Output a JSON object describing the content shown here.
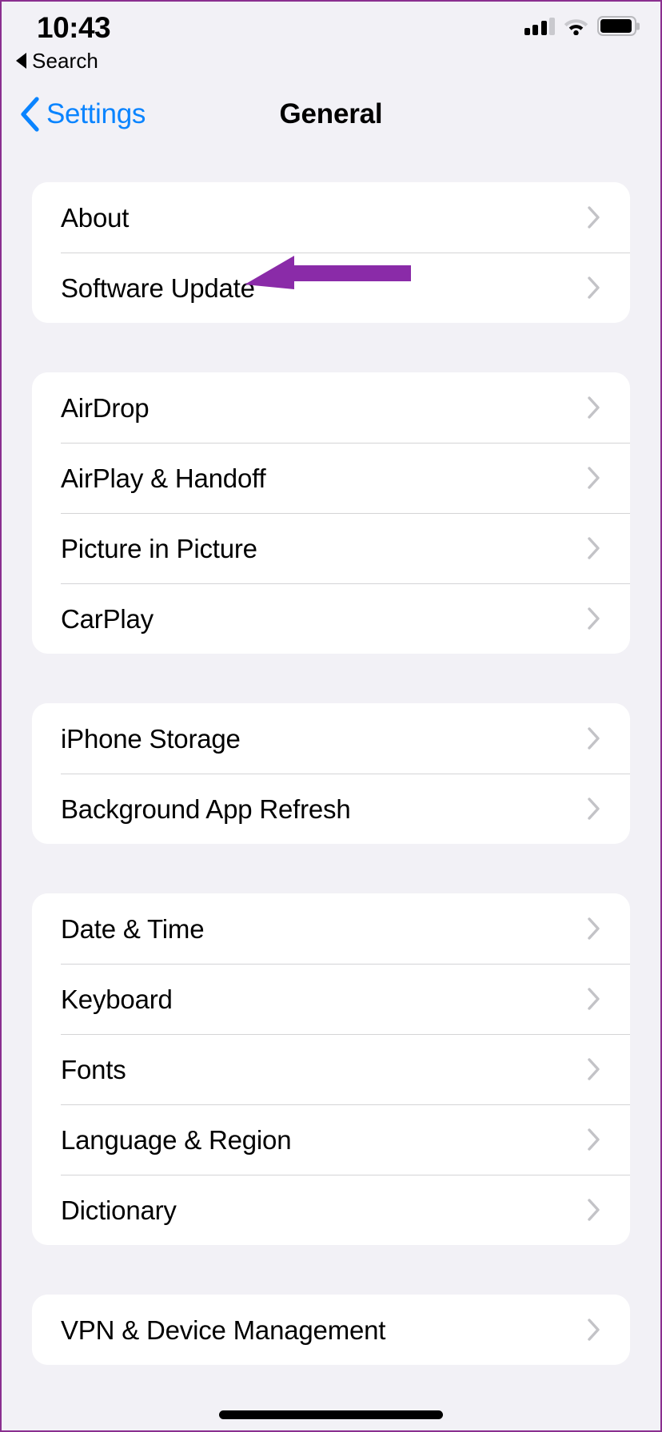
{
  "status_bar": {
    "time": "10:43",
    "signal_icon": "cellular-signal-icon",
    "signal_bars_filled": 3,
    "signal_bars_total": 4,
    "wifi_icon": "wifi-icon",
    "battery_icon": "battery-icon",
    "battery_level_percent": 96
  },
  "back_to_app": {
    "icon": "back-triangle-icon",
    "label": "Search"
  },
  "nav_bar": {
    "back_icon": "chevron-left-icon",
    "back_label": "Settings",
    "title": "General",
    "accent_color": "#0a84ff"
  },
  "annotation": {
    "type": "arrow-left",
    "color": "#8a2ba8",
    "points_to": "Software Update"
  },
  "groups": [
    {
      "rows": [
        {
          "label": "About",
          "chevron": "chevron-right-icon"
        },
        {
          "label": "Software Update",
          "chevron": "chevron-right-icon"
        }
      ]
    },
    {
      "rows": [
        {
          "label": "AirDrop",
          "chevron": "chevron-right-icon"
        },
        {
          "label": "AirPlay & Handoff",
          "chevron": "chevron-right-icon"
        },
        {
          "label": "Picture in Picture",
          "chevron": "chevron-right-icon"
        },
        {
          "label": "CarPlay",
          "chevron": "chevron-right-icon"
        }
      ]
    },
    {
      "rows": [
        {
          "label": "iPhone Storage",
          "chevron": "chevron-right-icon"
        },
        {
          "label": "Background App Refresh",
          "chevron": "chevron-right-icon"
        }
      ]
    },
    {
      "rows": [
        {
          "label": "Date & Time",
          "chevron": "chevron-right-icon"
        },
        {
          "label": "Keyboard",
          "chevron": "chevron-right-icon"
        },
        {
          "label": "Fonts",
          "chevron": "chevron-right-icon"
        },
        {
          "label": "Language & Region",
          "chevron": "chevron-right-icon"
        },
        {
          "label": "Dictionary",
          "chevron": "chevron-right-icon"
        }
      ]
    },
    {
      "rows": [
        {
          "label": "VPN & Device Management",
          "chevron": "chevron-right-icon"
        }
      ]
    }
  ],
  "home_indicator": "home-indicator"
}
